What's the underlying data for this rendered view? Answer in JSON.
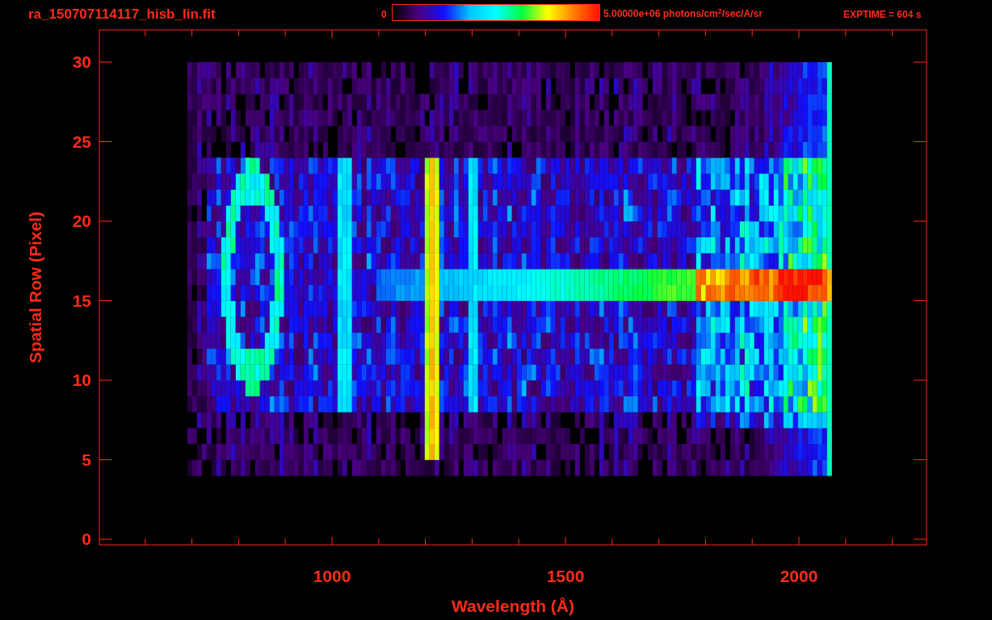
{
  "title": "ra_150707114117_hisb_lin.fit",
  "colorbar": {
    "min_label": "0",
    "max_label": "5.00000e+06 photons/cm$^{2}$/sec/A/sr"
  },
  "exposure": "EXPTIME = 604 s",
  "plot": {
    "ylabel": "Spatial Row (Pixel)",
    "xlabel": "Wavelength (Å)",
    "yticks": [
      "30",
      "25",
      "20",
      "15",
      "10",
      "5",
      "0"
    ],
    "xticks": [
      "1000",
      "1500",
      "2000"
    ]
  }
}
